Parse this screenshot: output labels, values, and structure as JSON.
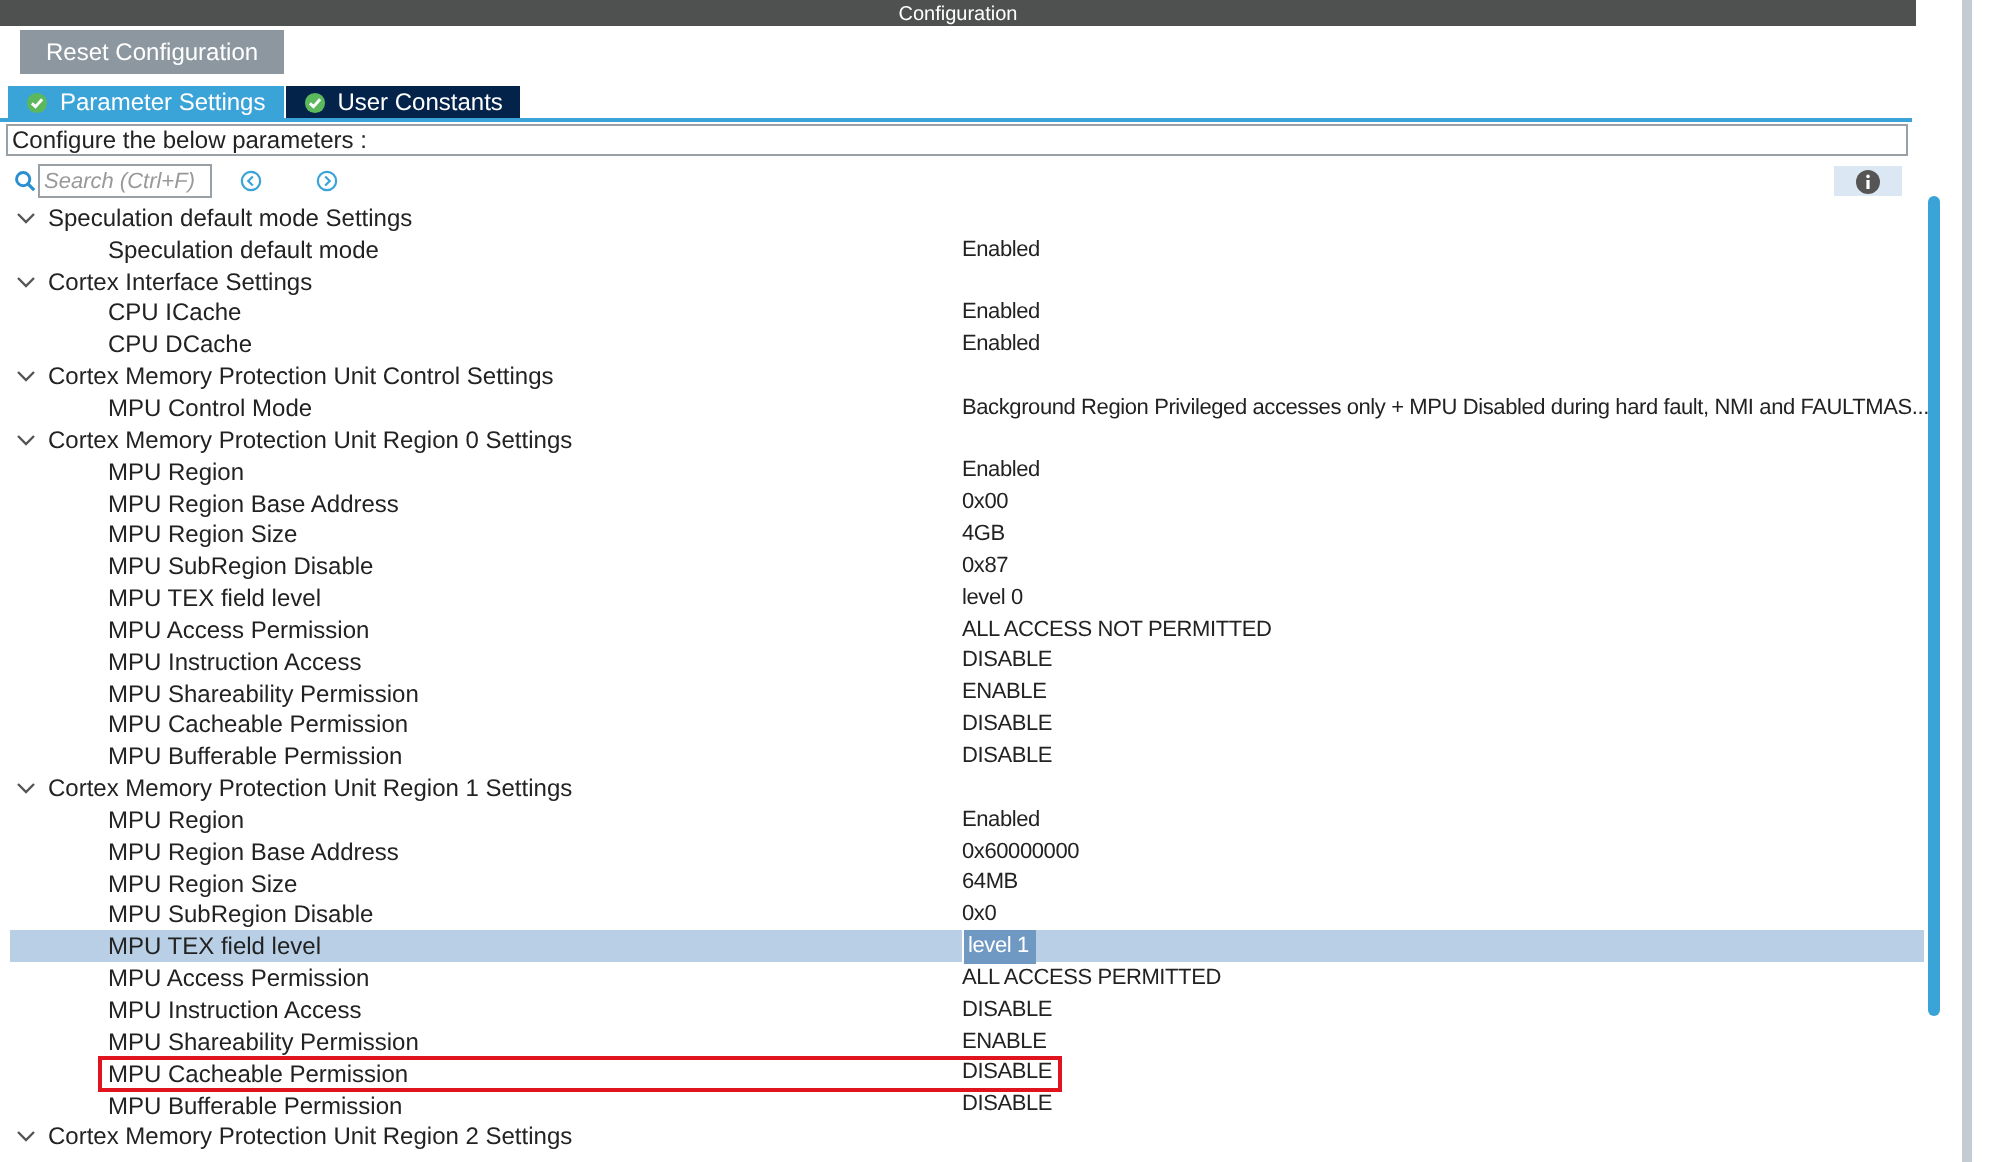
{
  "window": {
    "title": "Configuration"
  },
  "reset_button": {
    "label": "Reset Configuration",
    "disabled": true
  },
  "tabs": [
    {
      "label": "Parameter Settings",
      "selected": true
    },
    {
      "label": "User Constants",
      "selected": false
    }
  ],
  "description": "Configure the below parameters :",
  "search": {
    "placeholder": "Search (Ctrl+F)"
  },
  "groups": [
    {
      "title": "Speculation default mode Settings",
      "expanded": true,
      "children": [
        {
          "name": "Speculation default mode",
          "value": "Enabled",
          "selected": false,
          "outlined": false
        }
      ]
    },
    {
      "title": "Cortex Interface Settings",
      "expanded": true,
      "children": [
        {
          "name": "CPU ICache",
          "value": "Enabled",
          "selected": false,
          "outlined": false
        },
        {
          "name": "CPU DCache",
          "value": "Enabled",
          "selected": false,
          "outlined": false
        }
      ]
    },
    {
      "title": "Cortex Memory Protection Unit Control Settings",
      "expanded": true,
      "children": [
        {
          "name": "MPU Control Mode",
          "value": "Background Region Privileged accesses only + MPU Disabled during hard fault, NMI and FAULTMAS...",
          "selected": false,
          "outlined": false
        }
      ]
    },
    {
      "title": "Cortex Memory Protection Unit Region 0 Settings",
      "expanded": true,
      "children": [
        {
          "name": "MPU Region",
          "value": "Enabled",
          "selected": false,
          "outlined": false
        },
        {
          "name": "MPU Region Base Address",
          "value": "0x00",
          "selected": false,
          "outlined": false
        },
        {
          "name": "MPU Region Size",
          "value": "4GB",
          "selected": false,
          "outlined": false
        },
        {
          "name": "MPU SubRegion Disable",
          "value": "0x87",
          "selected": false,
          "outlined": false
        },
        {
          "name": "MPU TEX field level",
          "value": "level 0",
          "selected": false,
          "outlined": false
        },
        {
          "name": "MPU Access Permission",
          "value": "ALL ACCESS NOT PERMITTED",
          "selected": false,
          "outlined": false
        },
        {
          "name": "MPU Instruction Access",
          "value": "DISABLE",
          "selected": false,
          "outlined": false
        },
        {
          "name": "MPU Shareability Permission",
          "value": "ENABLE",
          "selected": false,
          "outlined": false
        },
        {
          "name": "MPU Cacheable Permission",
          "value": "DISABLE",
          "selected": false,
          "outlined": false
        },
        {
          "name": "MPU Bufferable  Permission",
          "value": "DISABLE",
          "selected": false,
          "outlined": false
        }
      ]
    },
    {
      "title": "Cortex Memory Protection Unit Region 1 Settings",
      "expanded": true,
      "children": [
        {
          "name": "MPU Region",
          "value": "Enabled",
          "selected": false,
          "outlined": false
        },
        {
          "name": "MPU Region Base Address",
          "value": "0x60000000",
          "selected": false,
          "outlined": false
        },
        {
          "name": "MPU Region Size",
          "value": "64MB",
          "selected": false,
          "outlined": false
        },
        {
          "name": "MPU SubRegion Disable",
          "value": "0x0",
          "selected": false,
          "outlined": false
        },
        {
          "name": "MPU TEX field level",
          "value": "level 1",
          "selected": true,
          "outlined": false
        },
        {
          "name": "MPU Access Permission",
          "value": "ALL ACCESS PERMITTED",
          "selected": false,
          "outlined": false
        },
        {
          "name": "MPU Instruction Access",
          "value": "DISABLE",
          "selected": false,
          "outlined": false
        },
        {
          "name": "MPU Shareability Permission",
          "value": "ENABLE",
          "selected": false,
          "outlined": false
        },
        {
          "name": "MPU Cacheable Permission",
          "value": "DISABLE",
          "selected": false,
          "outlined": true
        },
        {
          "name": "MPU Bufferable  Permission",
          "value": "DISABLE",
          "selected": false,
          "outlined": false
        }
      ]
    },
    {
      "title": "Cortex Memory Protection Unit Region 2 Settings",
      "expanded": true
    }
  ]
}
